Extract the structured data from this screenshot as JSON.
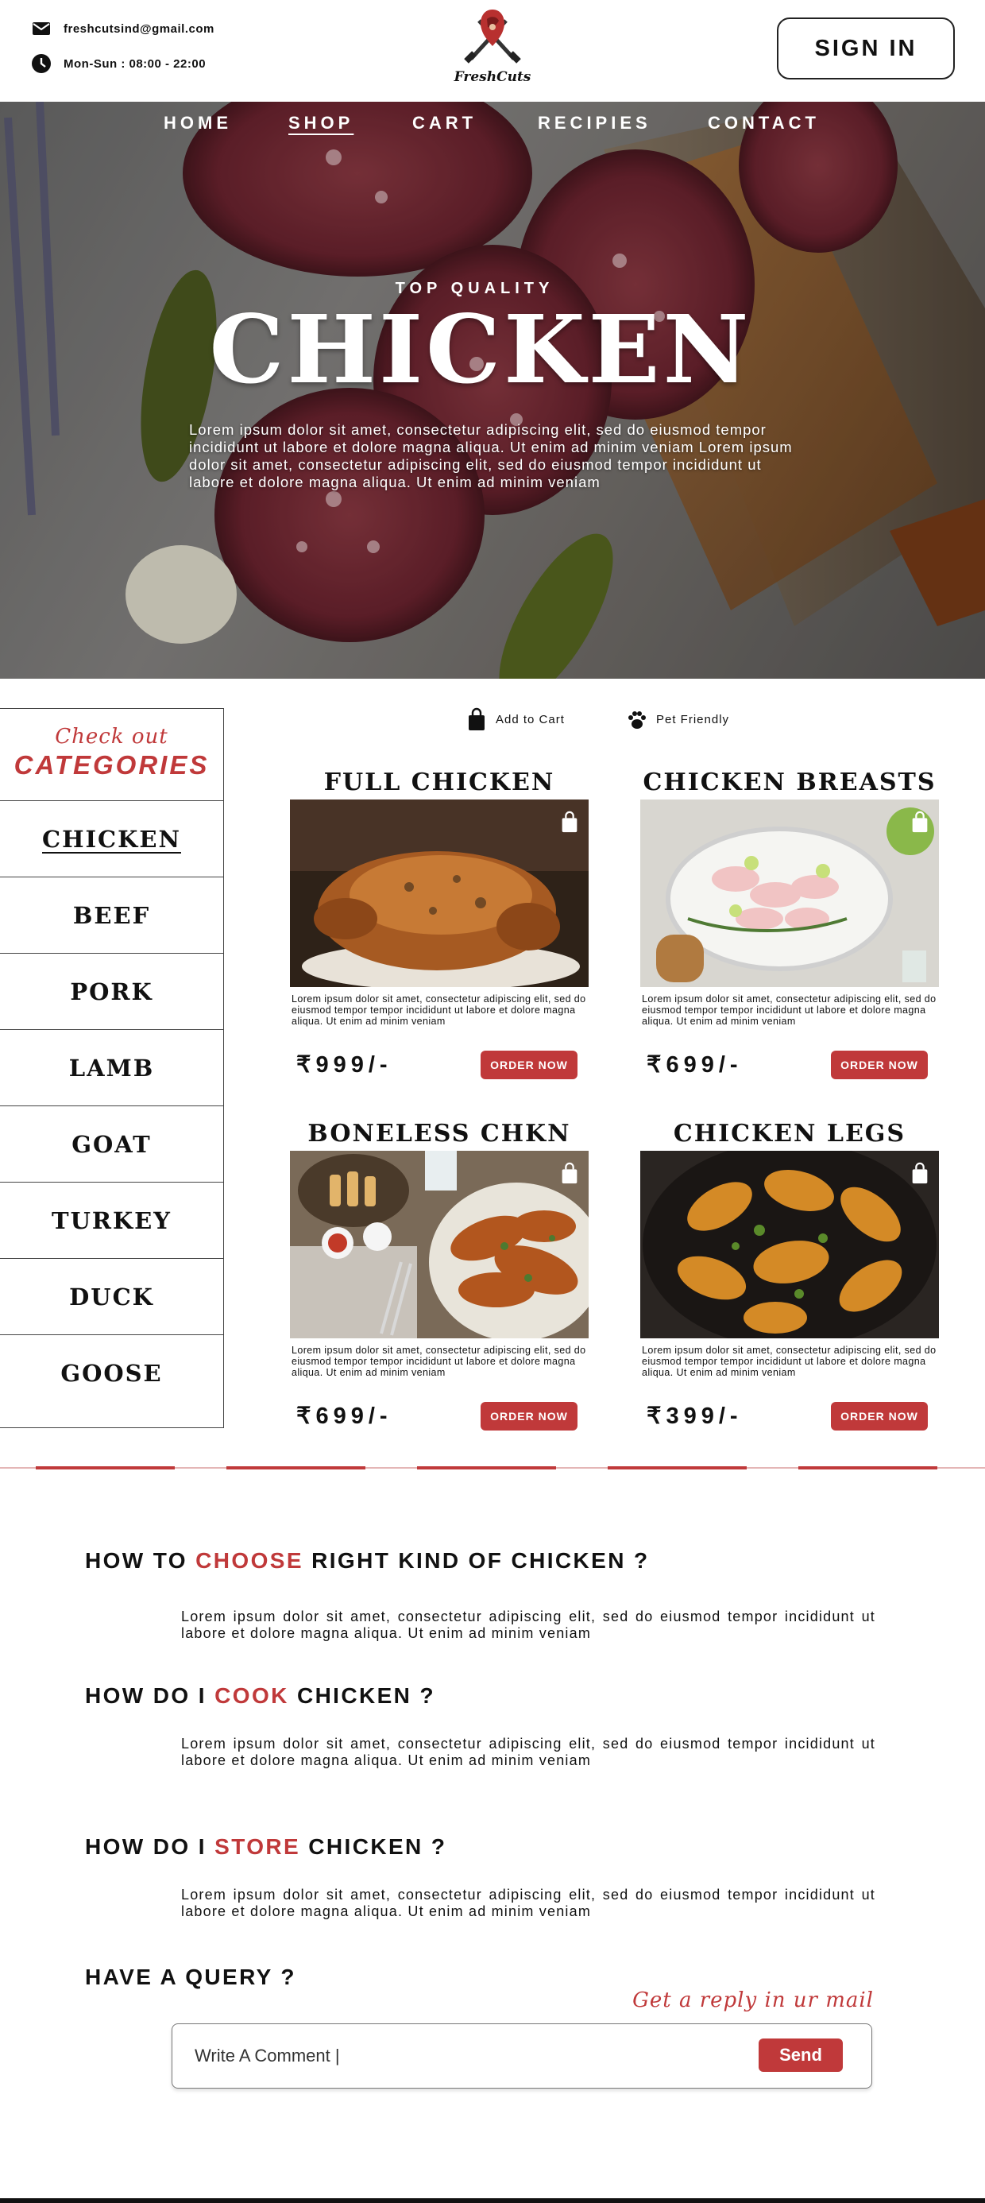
{
  "header": {
    "email": "freshcutsind@gmail.com",
    "hours": "Mon-Sun : 08:00 - 22:00",
    "logo_text": "FreshCuts",
    "sign_in": "SIGN IN"
  },
  "nav": [
    {
      "label": "HOME",
      "active": false
    },
    {
      "label": "SHOP",
      "active": true
    },
    {
      "label": "CART",
      "active": false
    },
    {
      "label": "RECIPIES",
      "active": false
    },
    {
      "label": "CONTACT",
      "active": false
    }
  ],
  "hero": {
    "kicker": "TOP QUALITY",
    "title": "CHICKEN",
    "text": "Lorem ipsum dolor sit amet, consectetur adipiscing elit, sed do eiusmod tempor incididunt ut labore et dolore magna aliqua. Ut enim ad minim veniam Lorem ipsum dolor sit amet, consectetur adipiscing elit, sed do eiusmod tempor incididunt ut labore et dolore magna aliqua. Ut enim ad minim veniam"
  },
  "sidebar": {
    "check_out": "Check out",
    "title": "CATEGORIES",
    "items": [
      "CHICKEN",
      "BEEF",
      "PORK",
      "LAMB",
      "GOAT",
      "TURKEY",
      "DUCK",
      "GOOSE"
    ],
    "active": "CHICKEN"
  },
  "legend": {
    "add_to_cart": "Add to Cart",
    "pet_friendly": "Pet Friendly"
  },
  "products": [
    {
      "title": "FULL CHICKEN",
      "desc": "Lorem ipsum dolor sit amet, consectetur adipiscing elit, sed do eiusmod tempor tempor incididunt ut labore et dolore magna aliqua. Ut enim ad minim veniam",
      "price": "₹999/-",
      "order": "ORDER NOW"
    },
    {
      "title": "CHICKEN BREASTS",
      "desc": "Lorem ipsum dolor sit amet, consectetur adipiscing elit, sed do eiusmod tempor tempor incididunt ut labore et dolore magna aliqua. Ut enim ad minim veniam",
      "price": "₹699/-",
      "order": "ORDER NOW"
    },
    {
      "title": "BONELESS CHKN",
      "desc": "Lorem ipsum dolor sit amet, consectetur adipiscing elit, sed do eiusmod tempor tempor incididunt ut labore et dolore magna aliqua. Ut enim ad minim veniam",
      "price": "₹699/-",
      "order": "ORDER NOW"
    },
    {
      "title": "CHICKEN LEGS",
      "desc": "Lorem ipsum dolor sit amet, consectetur adipiscing elit, sed do eiusmod tempor tempor incididunt ut labore et dolore magna aliqua. Ut enim ad minim veniam",
      "price": "₹399/-",
      "order": "ORDER NOW"
    }
  ],
  "faq": [
    {
      "pre": "HOW TO ",
      "hl": "CHOOSE",
      "post": " RIGHT KIND OF CHICKEN ?",
      "answer": "Lorem ipsum dolor sit amet, consectetur adipiscing elit, sed do eiusmod tempor incididunt ut labore et dolore magna aliqua. Ut enim ad minim veniam"
    },
    {
      "pre": "HOW DO I ",
      "hl": "COOK",
      "post": " CHICKEN ?",
      "answer": "Lorem ipsum dolor sit amet, consectetur adipiscing elit, sed do eiusmod tempor incididunt ut labore et dolore magna aliqua. Ut enim ad minim veniam"
    },
    {
      "pre": "HOW DO I ",
      "hl": "STORE",
      "post": " CHICKEN ?",
      "answer": "Lorem ipsum dolor sit amet, consectetur adipiscing elit, sed do eiusmod tempor incididunt ut labore et dolore magna aliqua. Ut enim ad minim veniam"
    }
  ],
  "query": {
    "title": "HAVE A QUERY ?",
    "reply": "Get a reply in ur mail",
    "placeholder": "Write A Comment |",
    "send": "Send"
  },
  "colors": {
    "accent": "#c0393a",
    "text": "#111111",
    "divider": "#e4b6b6"
  },
  "icons": [
    "mail-icon",
    "clock-icon",
    "logo-icon",
    "shopping-bag-icon",
    "paw-icon"
  ]
}
